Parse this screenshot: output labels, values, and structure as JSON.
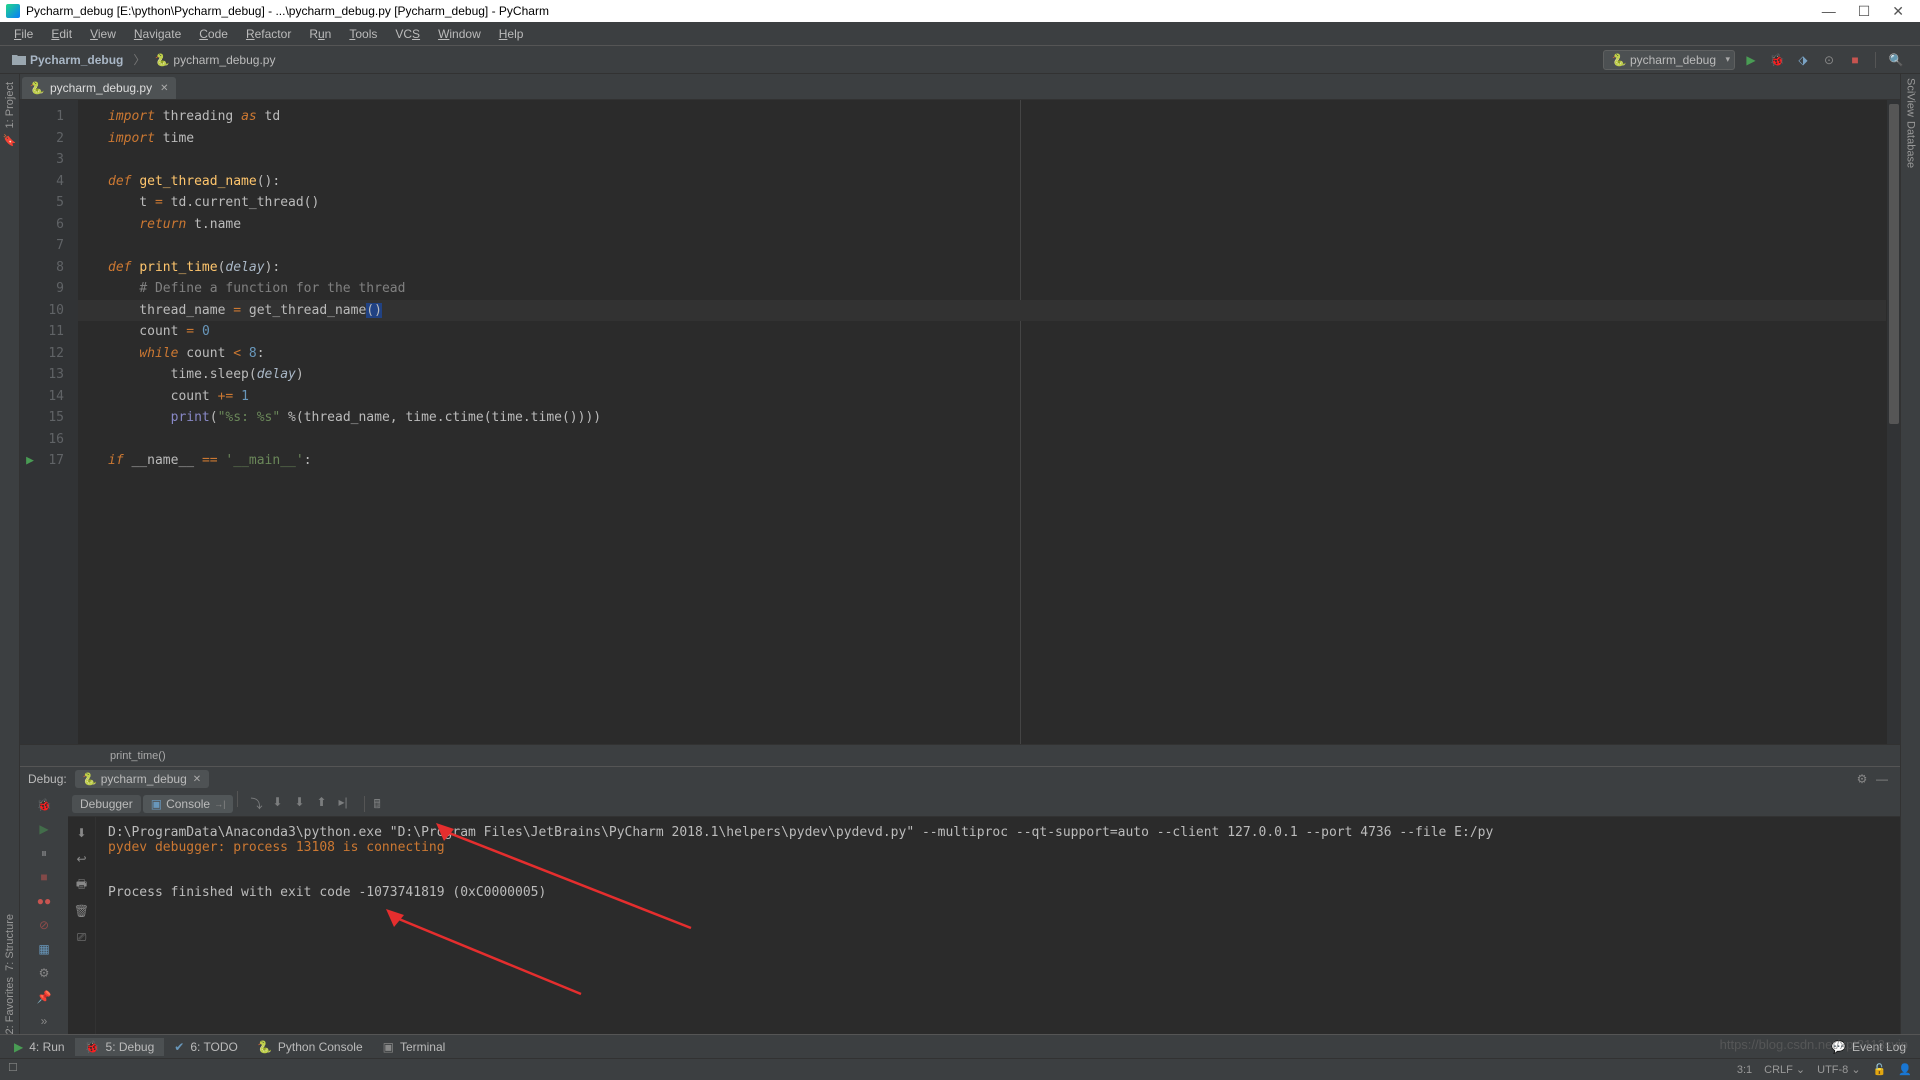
{
  "titlebar": {
    "text": "Pycharm_debug [E:\\python\\Pycharm_debug] - ...\\pycharm_debug.py [Pycharm_debug] - PyCharm"
  },
  "menu": {
    "items": [
      "File",
      "Edit",
      "View",
      "Navigate",
      "Code",
      "Refactor",
      "Run",
      "Tools",
      "VCS",
      "Window",
      "Help"
    ]
  },
  "breadcrumb": {
    "folder": "Pycharm_debug",
    "file": "pycharm_debug.py"
  },
  "run_config": {
    "name": "pycharm_debug"
  },
  "editor_tab": {
    "name": "pycharm_debug.py"
  },
  "code_breadcrumb": "print_time()",
  "code": {
    "l1_a": "import",
    "l1_b": " threading ",
    "l1_c": "as",
    "l1_d": " td",
    "l2_a": "import",
    "l2_b": " time",
    "l4_a": "def ",
    "l4_b": "get_thread_name",
    "l4_c": "():",
    "l5_a": "    t ",
    "l5_b": "=",
    "l5_c": " td.current_thread()",
    "l6_a": "    ",
    "l6_b": "return",
    "l6_c": " t.name",
    "l8_a": "def ",
    "l8_b": "print_time",
    "l8_c": "(",
    "l8_d": "delay",
    "l8_e": "):",
    "l9_a": "    ",
    "l9_b": "# Define a function for the thread",
    "l10_a": "    thread_name ",
    "l10_b": "=",
    "l10_c": " get_thread_name",
    "l10_d": "()",
    "l11_a": "    count ",
    "l11_b": "=",
    "l11_c": " ",
    "l11_d": "0",
    "l12_a": "    ",
    "l12_b": "while",
    "l12_c": " count ",
    "l12_d": "<",
    "l12_e": " ",
    "l12_f": "8",
    "l12_g": ":",
    "l13_a": "        time.sleep(",
    "l13_b": "delay",
    "l13_c": ")",
    "l14_a": "        count ",
    "l14_b": "+=",
    "l14_c": " ",
    "l14_d": "1",
    "l15_a": "        ",
    "l15_b": "print",
    "l15_c": "(",
    "l15_d": "\"%s: %s\"",
    "l15_e": " %(thread_name, time.ctime(time.time())))",
    "l17_a": "if",
    "l17_b": " __name__ ",
    "l17_c": "==",
    "l17_d": " ",
    "l17_e": "'__main__'",
    "l17_f": ":"
  },
  "line_numbers": [
    "1",
    "2",
    "3",
    "4",
    "5",
    "6",
    "7",
    "8",
    "9",
    "10",
    "11",
    "12",
    "13",
    "14",
    "15",
    "16",
    "17"
  ],
  "debug": {
    "label": "Debug:",
    "tab": "pycharm_debug",
    "subtabs": {
      "debugger": "Debugger",
      "console": "Console"
    }
  },
  "console": {
    "line1": "D:\\ProgramData\\Anaconda3\\python.exe \"D:\\Program Files\\JetBrains\\PyCharm 2018.1\\helpers\\pydev\\pydevd.py\" --multiproc --qt-support=auto --client 127.0.0.1 --port 4736 --file E:/py",
    "line2": "pydev debugger: process 13108 is connecting",
    "line3": "",
    "line4": "Process finished with exit code -1073741819 (0xC0000005)"
  },
  "bottom": {
    "run": "4: Run",
    "debug": "5: Debug",
    "todo": "6: TODO",
    "pyconsole": "Python Console",
    "terminal": "Terminal",
    "eventlog": "Event Log"
  },
  "status": {
    "pos": "3:1",
    "crlf": "CRLF",
    "enc": "UTF-8",
    "lock": "🔒"
  },
  "left_tools": {
    "project": "1: Project",
    "structure": "7: Structure",
    "favorites": "2: Favorites"
  },
  "right_tools": {
    "sciview": "SciView",
    "database": "Database"
  },
  "watermark": "https://blog.csdn.net/xpt2113svip"
}
